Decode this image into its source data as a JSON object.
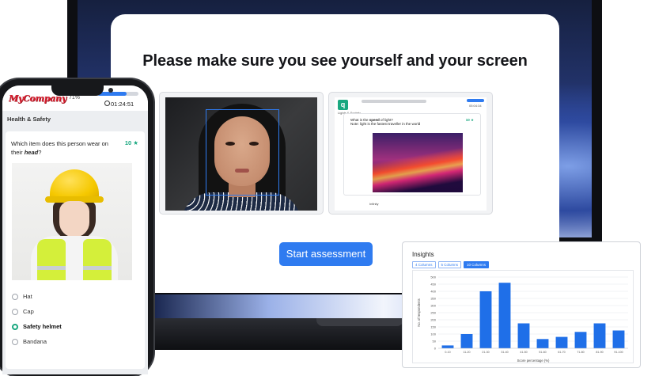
{
  "dialog": {
    "title": "Please make sure you see yourself and your screen",
    "start_button": "Start assessment"
  },
  "mini_screen": {
    "breadcrumb": "Lights & Society",
    "timer": "05:04:34",
    "question_prefix": "What is the ",
    "question_emph": "speed",
    "question_suffix": " of light?",
    "hint": "Note: light is the fastest traveller in the world",
    "points": "10",
    "option": "Infinity"
  },
  "phone": {
    "brand": "MyCompany",
    "progress_pct": "71%",
    "progress_value": 0.71,
    "timer": "01:24:51",
    "section": "Health & Safety",
    "question_main": "Which item does this person wear on their ",
    "question_emph": "head",
    "question_end": "?",
    "points": "10",
    "options": [
      {
        "label": "Hat",
        "selected": false
      },
      {
        "label": "Cap",
        "selected": false
      },
      {
        "label": "Safety helmet",
        "selected": true
      },
      {
        "label": "Bandana",
        "selected": false
      }
    ]
  },
  "insights": {
    "title": "Insights",
    "tabs": [
      {
        "label": "4 Columns",
        "active": false
      },
      {
        "label": "5 Columns",
        "active": false
      },
      {
        "label": "10 Columns",
        "active": true
      }
    ]
  },
  "colors": {
    "accent": "#2f7bf0",
    "success": "#1aa880",
    "brand_red": "#d71f2f"
  },
  "chart_data": {
    "type": "bar",
    "categories": [
      "0-10",
      "11-20",
      "21-30",
      "31-40",
      "41-50",
      "51-60",
      "61-70",
      "71-80",
      "81-90",
      "91-100"
    ],
    "values": [
      20,
      100,
      400,
      460,
      175,
      65,
      80,
      115,
      175,
      125
    ],
    "ylim": [
      0,
      500
    ],
    "yticks": [
      0,
      50,
      100,
      150,
      200,
      250,
      300,
      350,
      400,
      450,
      500
    ],
    "xlabel": "Score percentage (%)",
    "ylabel": "No. of respondents",
    "grid": true,
    "bar_color": "#1f6fe8"
  }
}
